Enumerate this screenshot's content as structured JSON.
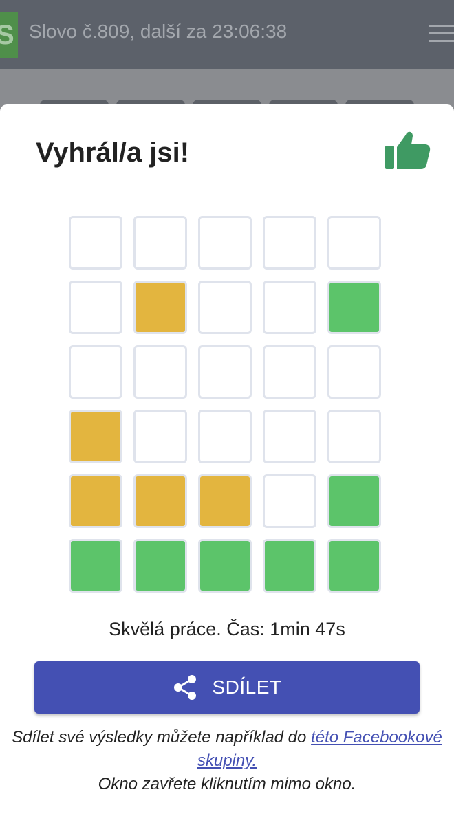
{
  "topbar": {
    "logo_letter": "S",
    "title": "Slovo č.809, další za 23:06:38"
  },
  "modal": {
    "title": "Vyhrál/a jsi!",
    "icon": "thumbs-up-icon",
    "grid": [
      [
        "empty",
        "empty",
        "empty",
        "empty",
        "empty"
      ],
      [
        "empty",
        "present",
        "empty",
        "empty",
        "correct"
      ],
      [
        "empty",
        "empty",
        "empty",
        "empty",
        "empty"
      ],
      [
        "present",
        "empty",
        "empty",
        "empty",
        "empty"
      ],
      [
        "present",
        "present",
        "present",
        "empty",
        "correct"
      ],
      [
        "correct",
        "correct",
        "correct",
        "correct",
        "correct"
      ]
    ],
    "result_text": "Skvělá práce. Čas: 1min 47s",
    "share_label": "SDÍLET",
    "info_line1_prefix": "Sdílet své výsledky můžete například do ",
    "info_link": "této Facebookové skupiny.",
    "info_line2": "Okno zavřete kliknutím mimo okno."
  },
  "colors": {
    "present": "#e3b53f",
    "correct": "#5cc46a",
    "empty": "#ffffff",
    "share_button": "#4450b3",
    "thumb": "#3f9a63"
  }
}
